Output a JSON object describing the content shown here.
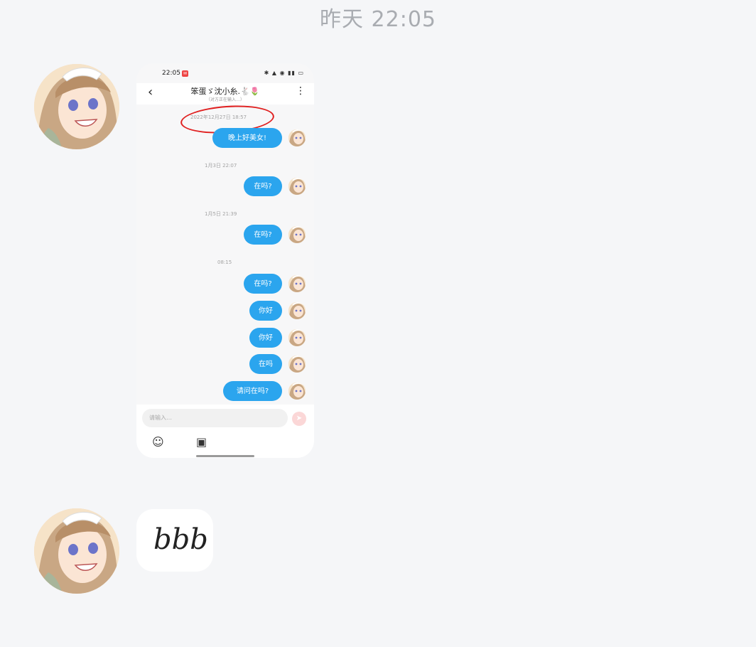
{
  "timestamp": "昨天 22:05",
  "screenshot": {
    "status_bar": {
      "time": "22:05",
      "icons": "✱ ▲ ◉ ▮▮ ▭"
    },
    "nav": {
      "title": "笨蛋ゞ沈小糸.🐇🌷",
      "subtitle": "（对方正在输入…）"
    },
    "messages": [
      {
        "time_label": "2022年12月27日 18:57",
        "text": "晚上好美女!"
      },
      {
        "time_label": "1月3日 22:07",
        "text": "在吗?"
      },
      {
        "time_label": "1月5日 21:39",
        "text": "在吗?"
      },
      {
        "time_label": "08:15",
        "text": "在吗?"
      },
      {
        "time_label": "",
        "text": "你好"
      },
      {
        "time_label": "",
        "text": "你好"
      },
      {
        "time_label": "",
        "text": "在吗"
      },
      {
        "time_label": "",
        "text": "请问在吗?"
      }
    ],
    "input": {
      "placeholder": "请输入…"
    },
    "bubble_color": "#2ba5ee"
  },
  "second_message": {
    "text": "bbb"
  }
}
